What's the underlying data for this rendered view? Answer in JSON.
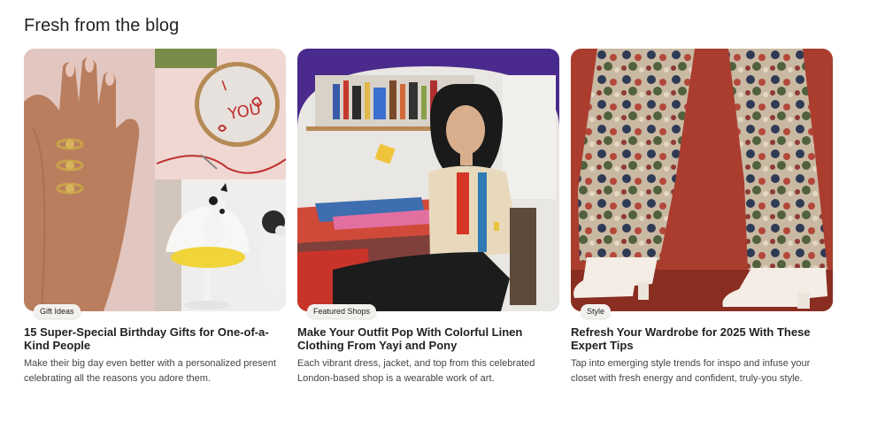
{
  "section": {
    "title": "Fresh from the blog"
  },
  "cards": [
    {
      "tag": "Gift Ideas",
      "title": "15 Super-Special Birthday Gifts for One-of-a-Kind People",
      "description": "Make their big day even better with a personalized present celebrating all the reasons you adore them.",
      "image": "collage-rings-embroidery-dog-chair"
    },
    {
      "tag": "Featured Shops",
      "title": "Make Your Outfit Pop With Colorful Linen Clothing From Yayi and Pony",
      "description": "Each vibrant dress, jacket, and top from this celebrated London-based shop is a wearable work of art.",
      "image": "woman-seated-studio-purple-arch"
    },
    {
      "tag": "Style",
      "title": "Refresh Your Wardrobe for 2025 With These Expert Tips",
      "description": "Tap into emerging style trends for inspo and infuse your closet with fresh energy and confident, truly-you style.",
      "image": "floral-pants-white-boots-red-background"
    }
  ]
}
